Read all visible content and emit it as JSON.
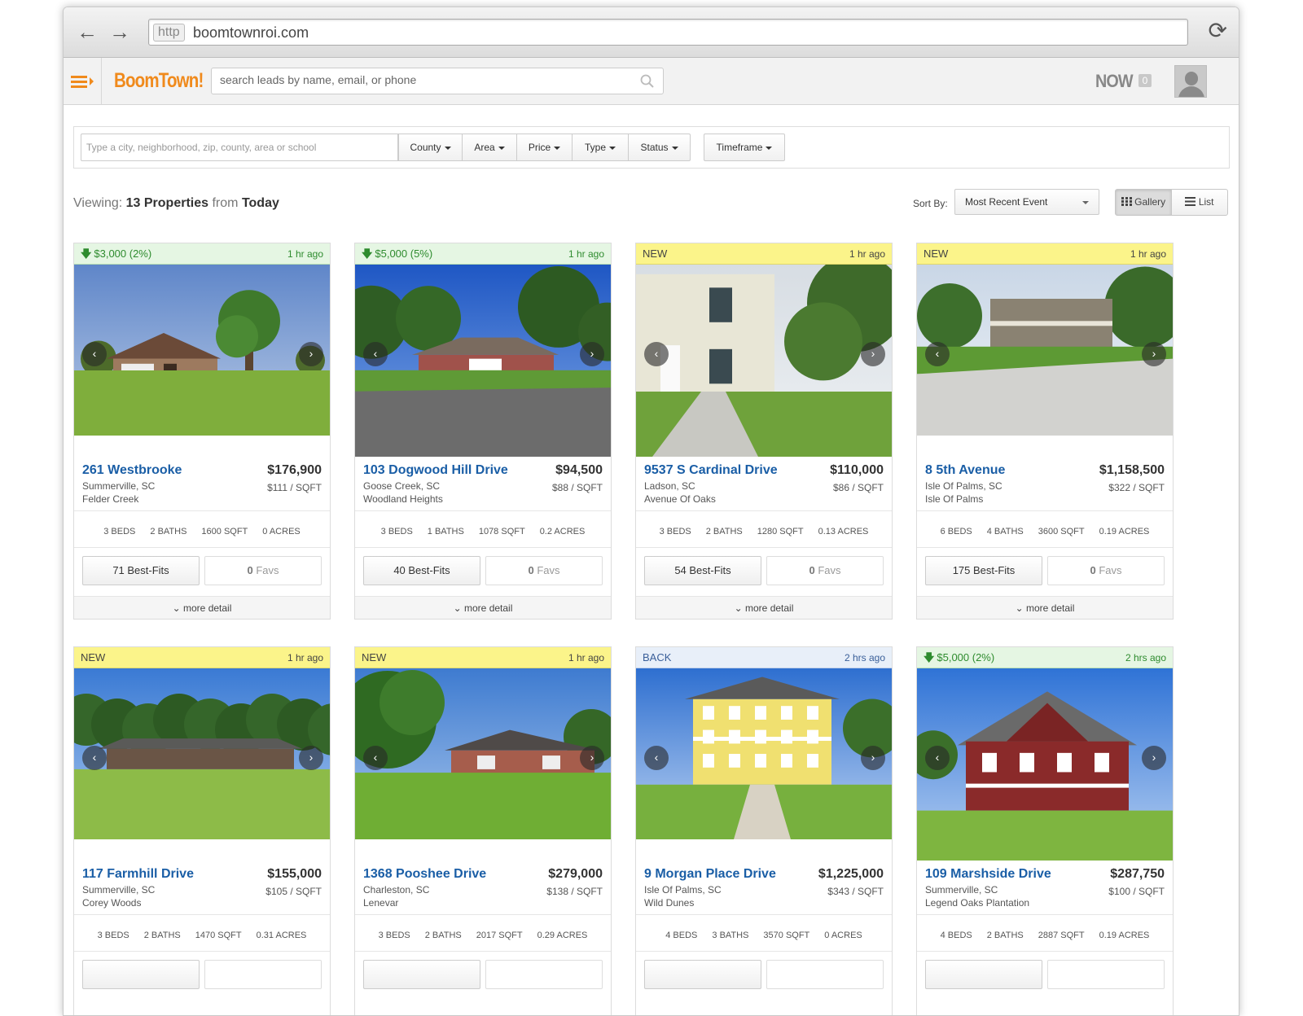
{
  "browser": {
    "url_protocol": "http",
    "url": "boomtownroi.com"
  },
  "app": {
    "logo": "BoomTown!",
    "lead_search_placeholder": "search leads by name, email, or phone",
    "now_label": "NOW",
    "now_count": "0"
  },
  "filters": {
    "location_placeholder": "Type a city, neighborhood, zip, county, area or school",
    "buttons": [
      "County",
      "Area",
      "Price",
      "Type",
      "Status"
    ],
    "timeframe": "Timeframe"
  },
  "summary": {
    "viewing_label": "Viewing:",
    "count": "13 Properties",
    "from_label": "from",
    "period": "Today"
  },
  "sort": {
    "label": "Sort By:",
    "selected": "Most Recent Event"
  },
  "view_toggle": {
    "gallery": "Gallery",
    "list": "List"
  },
  "more_detail_label": "more detail",
  "listings": [
    {
      "badge_type": "down",
      "badge": "$3,000 (2%)",
      "time": "1 hr ago",
      "address": "261 Westbrooke",
      "price": "$176,900",
      "city": "Summerville, SC",
      "price_per_sqft": "$111 / SQFT",
      "neighborhood": "Felder Creek",
      "beds": "3 BEDS",
      "baths": "2 BATHS",
      "sqft": "1600 SQFT",
      "acres": "0 ACRES",
      "best_fits": "71 Best-Fits",
      "favs": "0",
      "favs_label": "Favs",
      "photo_type": "brick-garage"
    },
    {
      "badge_type": "down",
      "badge": "$5,000 (5%)",
      "time": "1 hr ago",
      "address": "103 Dogwood Hill Drive",
      "price": "$94,500",
      "city": "Goose Creek, SC",
      "price_per_sqft": "$88 / SQFT",
      "neighborhood": "Woodland Heights",
      "beds": "3 BEDS",
      "baths": "1 BATHS",
      "sqft": "1078 SQFT",
      "acres": "0.2 ACRES",
      "best_fits": "40 Best-Fits",
      "favs": "0",
      "favs_label": "Favs",
      "photo_type": "ranch-road"
    },
    {
      "badge_type": "new",
      "badge": "NEW",
      "time": "1 hr ago",
      "address": "9537 S Cardinal Drive",
      "price": "$110,000",
      "city": "Ladson, SC",
      "price_per_sqft": "$86 / SQFT",
      "neighborhood": "Avenue Of Oaks",
      "beds": "3 BEDS",
      "baths": "2 BATHS",
      "sqft": "1280 SQFT",
      "acres": "0.13 ACRES",
      "best_fits": "54 Best-Fits",
      "favs": "0",
      "favs_label": "Favs",
      "photo_type": "siding"
    },
    {
      "badge_type": "new",
      "badge": "NEW",
      "time": "1 hr ago",
      "address": "8 5th Avenue",
      "price": "$1,158,500",
      "city": "Isle Of Palms, SC",
      "price_per_sqft": "$322 / SQFT",
      "neighborhood": "Isle Of Palms",
      "beds": "6 BEDS",
      "baths": "4 BATHS",
      "sqft": "3600 SQFT",
      "acres": "0.19 ACRES",
      "best_fits": "175 Best-Fits",
      "favs": "0",
      "favs_label": "Favs",
      "photo_type": "palms"
    },
    {
      "badge_type": "new",
      "badge": "NEW",
      "time": "1 hr ago",
      "address": "117 Farmhill Drive",
      "price": "$155,000",
      "city": "Summerville, SC",
      "price_per_sqft": "$105 / SQFT",
      "neighborhood": "Corey Woods",
      "beds": "3 BEDS",
      "baths": "2 BATHS",
      "sqft": "1470 SQFT",
      "acres": "0.31 ACRES",
      "best_fits": "",
      "favs": "",
      "favs_label": "",
      "photo_type": "ranch-trees"
    },
    {
      "badge_type": "new",
      "badge": "NEW",
      "time": "1 hr ago",
      "address": "1368 Pooshee Drive",
      "price": "$279,000",
      "city": "Charleston, SC",
      "price_per_sqft": "$138 / SQFT",
      "neighborhood": "Lenevar",
      "beds": "3 BEDS",
      "baths": "2 BATHS",
      "sqft": "2017 SQFT",
      "acres": "0.29 ACRES",
      "best_fits": "",
      "favs": "",
      "favs_label": "",
      "photo_type": "brick-tree"
    },
    {
      "badge_type": "back",
      "badge": "BACK",
      "time": "2 hrs ago",
      "address": "9 Morgan Place Drive",
      "price": "$1,225,000",
      "city": "Isle Of Palms, SC",
      "price_per_sqft": "$343 / SQFT",
      "neighborhood": "Wild Dunes",
      "beds": "4 BEDS",
      "baths": "3 BATHS",
      "sqft": "3570 SQFT",
      "acres": "0 ACRES",
      "best_fits": "",
      "favs": "",
      "favs_label": "",
      "photo_type": "yellow"
    },
    {
      "badge_type": "down",
      "badge": "$5,000 (2%)",
      "time": "2 hrs ago",
      "address": "109 Marshside Drive",
      "price": "$287,750",
      "city": "Summerville, SC",
      "price_per_sqft": "$100 / SQFT",
      "neighborhood": "Legend Oaks Plantation",
      "beds": "4 BEDS",
      "baths": "2 BATHS",
      "sqft": "2887 SQFT",
      "acres": "0.19 ACRES",
      "best_fits": "",
      "favs": "",
      "favs_label": "",
      "photo_type": "red"
    }
  ],
  "colors": {
    "accent": "#f08a1c",
    "link": "#1a5ea6",
    "price_drop": "#2e8b2e",
    "new_badge": "#fbf48a",
    "back_badge": "#e8eff9"
  }
}
